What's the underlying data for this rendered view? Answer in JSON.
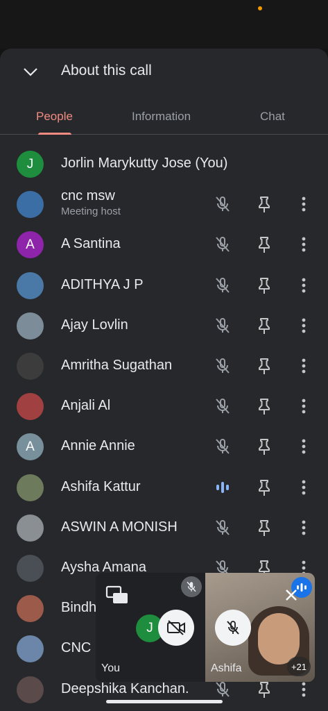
{
  "header": {
    "title": "About this call",
    "collapse_icon": "chevron-down-icon"
  },
  "tabs": [
    {
      "label": "People",
      "active": true
    },
    {
      "label": "Information",
      "active": false
    },
    {
      "label": "Chat",
      "active": false
    }
  ],
  "participants": [
    {
      "name": "Jorlin Marykutty Jose (You)",
      "avatar_letter": "J",
      "avatar_color": "#1e8e3e",
      "controls": false
    },
    {
      "name": "cnc msw",
      "subtitle": "Meeting host",
      "avatar_letter": "",
      "avatar_color": "#3a6ea5",
      "mic": "muted"
    },
    {
      "name": "A Santina",
      "avatar_letter": "A",
      "avatar_color": "#8e24aa",
      "mic": "muted"
    },
    {
      "name": "ADITHYA J P",
      "avatar_letter": "",
      "avatar_color": "#4a79a8",
      "mic": "muted"
    },
    {
      "name": "Ajay Lovlin",
      "avatar_letter": "",
      "avatar_color": "#7d8c99",
      "mic": "muted"
    },
    {
      "name": "Amritha Sugathan",
      "avatar_letter": "",
      "avatar_color": "#3c3c3c",
      "mic": "muted"
    },
    {
      "name": "Anjali Al",
      "avatar_letter": "",
      "avatar_color": "#a14040",
      "mic": "muted"
    },
    {
      "name": "Annie Annie",
      "avatar_letter": "A",
      "avatar_color": "#78909c",
      "mic": "muted"
    },
    {
      "name": "Ashifa Kattur",
      "avatar_letter": "",
      "avatar_color": "#6d7a5c",
      "mic": "speaking"
    },
    {
      "name": "ASWIN A MONISH",
      "avatar_letter": "",
      "avatar_color": "#8a8f94",
      "mic": "muted"
    },
    {
      "name": "Aysha Amana",
      "avatar_letter": "",
      "avatar_color": "#4a4f55",
      "mic": "muted"
    },
    {
      "name": "Bindh",
      "avatar_letter": "",
      "avatar_color": "#9c5a4a",
      "mic": "muted"
    },
    {
      "name": "CNC",
      "avatar_letter": "",
      "avatar_color": "#6b86a8",
      "mic": "muted"
    },
    {
      "name": "Deepshika Kanchan.",
      "avatar_letter": "",
      "avatar_color": "#5a4a4a",
      "mic": "muted"
    }
  ],
  "pip": {
    "you_label": "You",
    "you_letter": "J",
    "remote_label": "Ashifa",
    "others_count": "+21"
  },
  "colors": {
    "accent": "#f28b82",
    "speaking": "#8ab4f8",
    "background": "#27282c"
  }
}
